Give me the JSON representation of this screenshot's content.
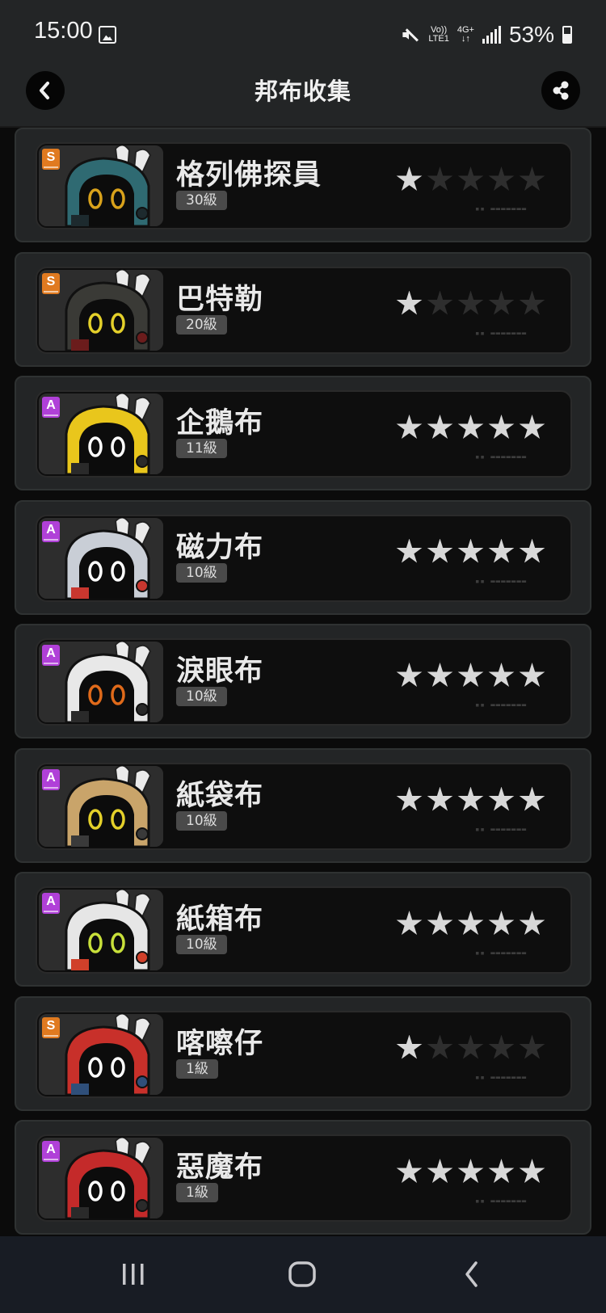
{
  "status_bar": {
    "time": "15:00",
    "network_top": "Vo))",
    "network_bottom": "LTE1",
    "data_top": "4G+",
    "data_bottom": "↓↑",
    "battery": "53%"
  },
  "header": {
    "title": "邦布收集"
  },
  "colors": {
    "rank_s": "#e07a20",
    "rank_a": "#b040d8",
    "star_on": "#d8d8d8",
    "star_off": "#2e2e2e"
  },
  "bangboos": [
    {
      "rank": "S",
      "name": "格列佛探員",
      "level": "30級",
      "stars": 1,
      "body": "#2f6a72",
      "eye": "#d9a21b",
      "accent": "#1d2a2e"
    },
    {
      "rank": "S",
      "name": "巴特勒",
      "level": "20級",
      "stars": 1,
      "body": "#3a3a36",
      "eye": "#e4d02a",
      "accent": "#6b1c1c"
    },
    {
      "rank": "A",
      "name": "企鵝布",
      "level": "11級",
      "stars": 5,
      "body": "#e9c61c",
      "eye": "#ffffff",
      "accent": "#2a2a2a"
    },
    {
      "rank": "A",
      "name": "磁力布",
      "level": "10級",
      "stars": 5,
      "body": "#c9ced6",
      "eye": "#ffffff",
      "accent": "#c8372f"
    },
    {
      "rank": "A",
      "name": "淚眼布",
      "level": "10級",
      "stars": 5,
      "body": "#e8e8e8",
      "eye": "#e06a1a",
      "accent": "#2a2a2a"
    },
    {
      "rank": "A",
      "name": "紙袋布",
      "level": "10級",
      "stars": 5,
      "body": "#c9a46a",
      "eye": "#e4d02a",
      "accent": "#3a3a3a"
    },
    {
      "rank": "A",
      "name": "紙箱布",
      "level": "10級",
      "stars": 5,
      "body": "#e6e6e6",
      "eye": "#c8e03a",
      "accent": "#d0402a"
    },
    {
      "rank": "S",
      "name": "喀嚓仔",
      "level": "1級",
      "stars": 1,
      "body": "#c8302a",
      "eye": "#ffffff",
      "accent": "#2f4f7a"
    },
    {
      "rank": "A",
      "name": "惡魔布",
      "level": "1級",
      "stars": 5,
      "body": "#c42a2a",
      "eye": "#ffffff",
      "accent": "#2a2a2a"
    }
  ],
  "icons": {
    "back": "chevron-left-icon",
    "share": "share-icon",
    "recents": "recents-icon",
    "home": "home-icon",
    "nav_back": "nav-back-icon"
  }
}
